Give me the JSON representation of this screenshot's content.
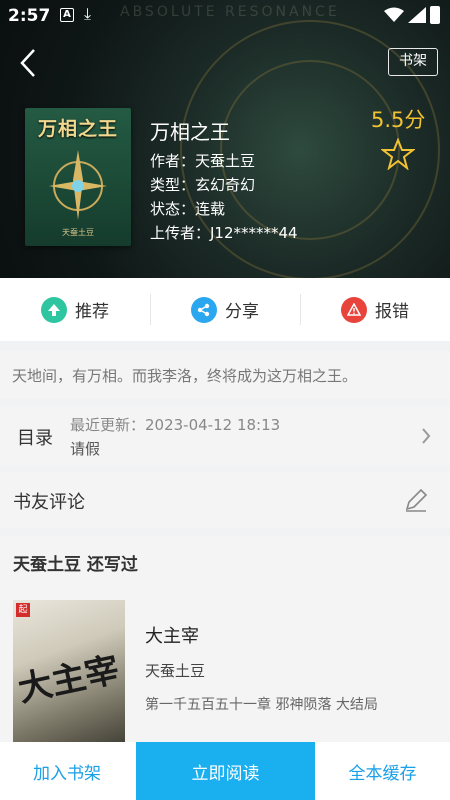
{
  "status": {
    "time": "2:57",
    "a_icon": "A"
  },
  "header": {
    "shelf_label": "书架",
    "bg_text": "ABSOLUTE RESONANCE"
  },
  "book": {
    "cover_title": "万相之王",
    "cover_author": "天蚕土豆",
    "title": "万相之王",
    "author_line": "作者：天蚕土豆",
    "type_line": "类型：玄幻奇幻",
    "state_line": "状态：连载",
    "uploader_line": "上传者：J12******44",
    "score": "5.5分"
  },
  "actions": [
    {
      "label": "推荐",
      "color": "#2ec6a0"
    },
    {
      "label": "分享",
      "color": "#2aa7ef"
    },
    {
      "label": "报错",
      "color": "#e8443b"
    }
  ],
  "intro": "天地间，有万相。而我李洛，终将成为这万相之王。",
  "toc": {
    "label": "目录",
    "update": "最近更新：2023-04-12 18:13",
    "latest": "请假"
  },
  "reviews": {
    "label": "书友评论"
  },
  "also": {
    "title": "天蚕土豆  还写过",
    "cover_title": "大主宰",
    "cover_badge": "起",
    "book_title": "大主宰",
    "book_author": "天蚕土豆",
    "book_chapter": "第一千五百五十一章 邪神陨落 大结局"
  },
  "bottom": {
    "add_shelf": "加入书架",
    "read_now": "立即阅读",
    "cache_all": "全本缓存"
  },
  "colors": {
    "accent": "#1ab0f0",
    "score": "#f1c232"
  }
}
